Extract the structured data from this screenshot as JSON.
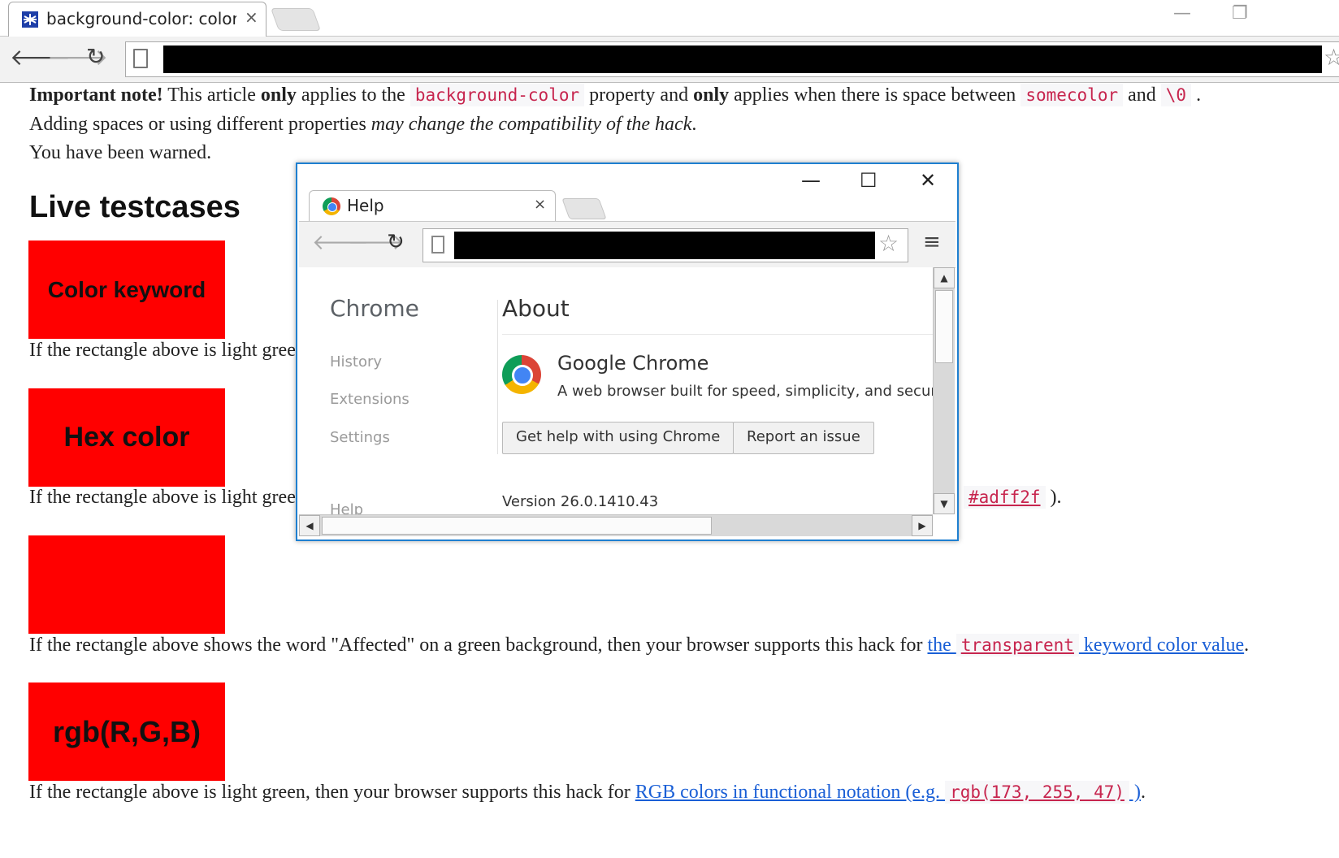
{
  "outer_browser": {
    "tab_title": "background-color: color\\",
    "tab_close": "×",
    "back": "🡐",
    "forward": "🡒",
    "reload": "↻",
    "bookmark_star": "☆",
    "minimize": "—",
    "restore": "❐",
    "favicon": "spider-favicon"
  },
  "article": {
    "note_bold": "Important note!",
    "note_t1": " This article ",
    "note_only1": "only",
    "note_t2": " applies to the ",
    "note_code1": "background-color",
    "note_t3": " property and ",
    "note_only2": "only",
    "note_t4": " applies when there is space between ",
    "note_code2": "somecolor",
    "note_t5": " and ",
    "note_code3": "\\0",
    "note_t6": " .",
    "line2_t1": "Adding spaces or using different properties ",
    "line2_em": "may change the compatibility of the hack",
    "line2_t2": ".",
    "line3": "You have been warned.",
    "heading": "Live testcases"
  },
  "testcases": [
    {
      "box_label": "Color keyword",
      "caption": "If the rectangle above is light green"
    },
    {
      "box_label": "Hex color",
      "caption": "If the rectangle above is light green",
      "tail_link": "#adff2f",
      "tail_end": " )."
    },
    {
      "box_label": "",
      "caption_t1": "If the rectangle above shows the word \"Affected\" on a green background, then your browser supports this hack for ",
      "link_the": "the ",
      "link_code": "transparent",
      "link_rest": " keyword color value",
      "caption_end": "."
    },
    {
      "box_label": "rgb(R,G,B)",
      "caption_t1": "If the rectangle above is light green, then your browser supports this hack for ",
      "link_text": "RGB colors in functional notation (e.g. ",
      "link_code": "rgb(173, 255, 47)",
      "link_close": " )",
      "caption_end": "."
    }
  ],
  "popup": {
    "tab_title": "Help",
    "tab_close": "×",
    "win_minimize": "—",
    "win_maximize": "☐",
    "win_close": "✕",
    "back": "🡐",
    "forward": "🡒",
    "reload": "↻",
    "star": "☆",
    "menu": "≡",
    "sidebar_title": "Chrome",
    "nav_items": [
      "History",
      "Extensions",
      "Settings"
    ],
    "nav_cut": "Help",
    "section_title": "About",
    "product_name": "Google Chrome",
    "product_desc": "A web browser built for speed, simplicity, and security",
    "btn_help": "Get help with using Chrome",
    "btn_report": "Report an issue",
    "version": "Version 26.0.1410.43",
    "scroll_up": "▲",
    "scroll_down": "▼",
    "scroll_left": "◀",
    "scroll_right": "▶"
  },
  "colors": {
    "box_red": "#ff0000",
    "link_blue": "#1a5fd6",
    "code_pink": "#c7254e",
    "popup_border": "#1e7fd0"
  }
}
